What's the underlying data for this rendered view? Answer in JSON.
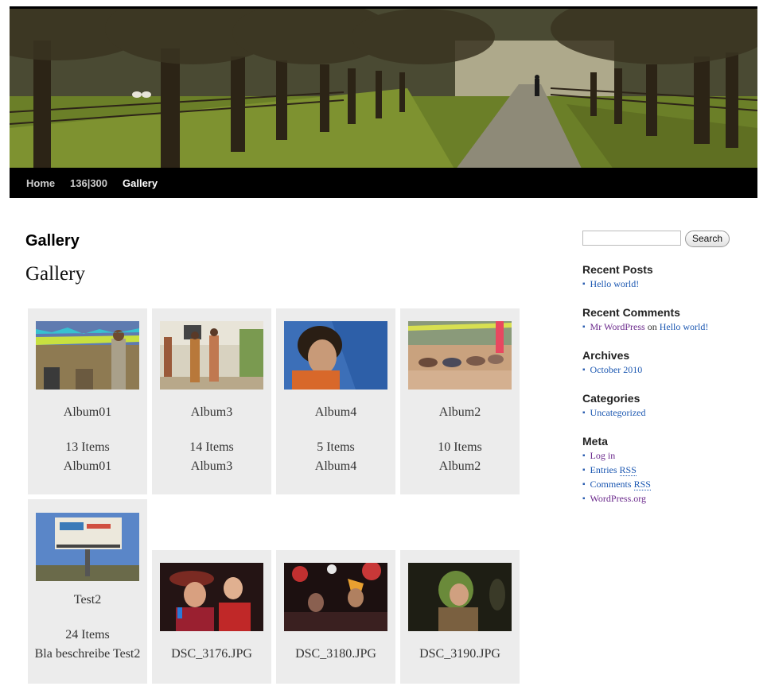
{
  "nav": {
    "items": [
      {
        "label": "Home"
      },
      {
        "label": "136|300"
      },
      {
        "label": "Gallery"
      }
    ]
  },
  "page": {
    "title": "Gallery",
    "heading": "Gallery"
  },
  "albums": [
    {
      "name": "Album01",
      "count": "13 Items",
      "desc": "Album01"
    },
    {
      "name": "Album3",
      "count": "14 Items",
      "desc": "Album3"
    },
    {
      "name": "Album4",
      "count": "5 Items",
      "desc": "Album4"
    },
    {
      "name": "Album2",
      "count": "10 Items",
      "desc": "Album2"
    },
    {
      "name": "Test2",
      "count": "24 Items",
      "desc": "Bla beschreibe Test2"
    }
  ],
  "images": [
    {
      "name": "DSC_3176.JPG"
    },
    {
      "name": "DSC_3180.JPG"
    },
    {
      "name": "DSC_3190.JPG"
    }
  ],
  "sidebar": {
    "search": {
      "button_label": "Search",
      "placeholder": ""
    },
    "recent_posts": {
      "title": "Recent Posts",
      "items": [
        "Hello world!"
      ]
    },
    "recent_comments": {
      "title": "Recent Comments",
      "author": "Mr WordPress",
      "on": "on",
      "post": "Hello world!"
    },
    "archives": {
      "title": "Archives",
      "items": [
        "October 2010"
      ]
    },
    "categories": {
      "title": "Categories",
      "items": [
        "Uncategorized"
      ]
    },
    "meta": {
      "title": "Meta",
      "login": "Log in",
      "entries_prefix": "Entries ",
      "entries_rss": "RSS",
      "comments_prefix": "Comments ",
      "comments_rss": "RSS",
      "wordpress": "WordPress.org"
    }
  },
  "colors": {
    "nav_bg": "#000000",
    "tile_bg": "#ececec",
    "link": "#1b57b1",
    "visited_link": "#6b2a8c"
  }
}
